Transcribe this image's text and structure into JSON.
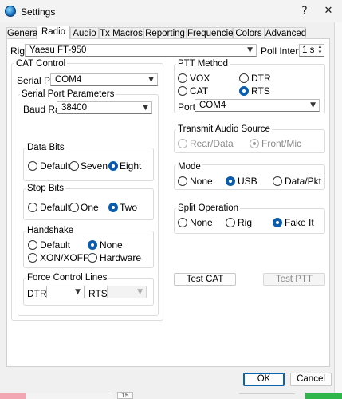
{
  "window": {
    "title": "Settings",
    "help_glyph": "?",
    "close_glyph": "✕"
  },
  "tabs": [
    {
      "label": "General",
      "active": false
    },
    {
      "label": "Radio",
      "active": true
    },
    {
      "label": "Audio",
      "active": false
    },
    {
      "label": "Tx Macros",
      "active": false
    },
    {
      "label": "Reporting",
      "active": false
    },
    {
      "label": "Frequencies",
      "active": false
    },
    {
      "label": "Colors",
      "active": false
    },
    {
      "label": "Advanced",
      "active": false
    }
  ],
  "rig": {
    "label": "Rig:",
    "value": "Yaesu FT-950",
    "poll_label": "Poll Interval:",
    "poll_value": "1 s"
  },
  "cat_control": {
    "title": "CAT Control",
    "serial_port_label": "Serial Port:",
    "serial_port_value": "COM4",
    "serial_params_title": "Serial Port Parameters",
    "baud_label": "Baud Rate:",
    "baud_value": "38400",
    "data_bits": {
      "title": "Data Bits",
      "options": [
        "Default",
        "Seven",
        "Eight"
      ],
      "selected": "Eight"
    },
    "stop_bits": {
      "title": "Stop Bits",
      "options": [
        "Default",
        "One",
        "Two"
      ],
      "selected": "Two"
    },
    "handshake": {
      "title": "Handshake",
      "options": [
        "Default",
        "None",
        "XON/XOFF",
        "Hardware"
      ],
      "selected": "None"
    },
    "force_lines": {
      "title": "Force Control Lines",
      "dtr_label": "DTR:",
      "rts_label": "RTS:",
      "dtr_value": "",
      "rts_value": ""
    }
  },
  "ptt": {
    "title": "PTT Method",
    "options": [
      "VOX",
      "DTR",
      "CAT",
      "RTS"
    ],
    "selected": "RTS",
    "port_label": "Port:",
    "port_value": "COM4"
  },
  "tx_audio": {
    "title": "Transmit Audio Source",
    "options": [
      "Rear/Data",
      "Front/Mic"
    ],
    "selected": "Front/Mic"
  },
  "mode": {
    "title": "Mode",
    "options": [
      "None",
      "USB",
      "Data/Pkt"
    ],
    "selected": "USB"
  },
  "split": {
    "title": "Split Operation",
    "options": [
      "None",
      "Rig",
      "Fake It"
    ],
    "selected": "Fake It"
  },
  "buttons": {
    "test_cat": "Test CAT",
    "test_ptt": "Test PTT",
    "ok": "OK",
    "cancel": "Cancel"
  },
  "background": {
    "status_number": "15"
  },
  "colors": {
    "accent": "#0b5cad",
    "panel_border": "#d0d0d0"
  }
}
